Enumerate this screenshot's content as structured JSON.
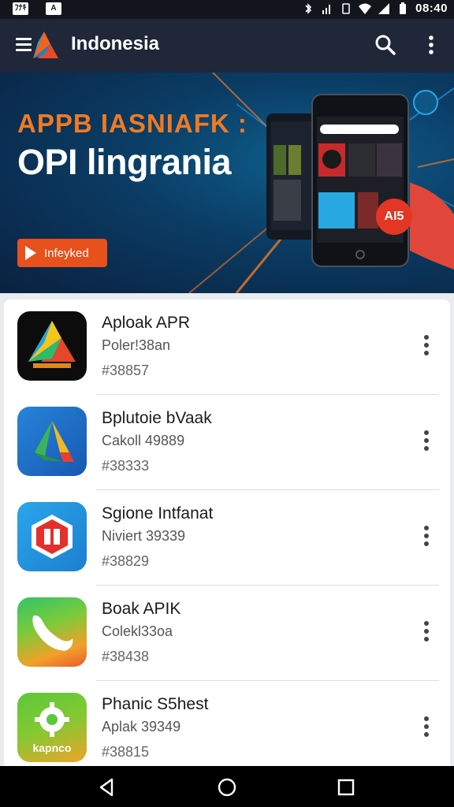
{
  "status_bar": {
    "left_badges": [
      "ﾌﾅｷ",
      "A"
    ],
    "time": "08:40",
    "icons": [
      "bluetooth-icon",
      "signal-icon",
      "vibrate-icon",
      "wifi-icon",
      "cell-signal-icon",
      "battery-icon"
    ]
  },
  "toolbar": {
    "title": "Indonesia",
    "icons": [
      "menu-icon",
      "app-logo-icon",
      "search-icon",
      "more-vert-icon"
    ]
  },
  "banner": {
    "title_line1": "APPB IASNIAFK :",
    "title_line2": "OPI lingrania",
    "button_label": "Infeyked",
    "badge_text": "AI5",
    "accent_color": "#e8501c"
  },
  "apps": [
    {
      "name": "Aploak APR",
      "subtitle": "Poler!38an",
      "number": "#38857",
      "icon": "prism-a-icon"
    },
    {
      "name": "Bplutoie bVaak",
      "subtitle": "Cakoll 49889",
      "number": "#38333",
      "icon": "drive-triangle-icon"
    },
    {
      "name": "Sgione Intfanat",
      "subtitle": "Niviert 39339",
      "number": "#38829",
      "icon": "red-hexagon-icon"
    },
    {
      "name": "Boak APIK",
      "subtitle": "Colekl33oa",
      "number": "#38438",
      "icon": "phone-swoosh-icon"
    },
    {
      "name": "Phanic S5hest",
      "subtitle": "Aplak 39349",
      "number": "#38815",
      "icon": "gear-leaf-icon",
      "icon_label": "kapnco"
    }
  ],
  "nav": {
    "icons": [
      "back-icon",
      "home-icon",
      "recents-icon"
    ]
  }
}
